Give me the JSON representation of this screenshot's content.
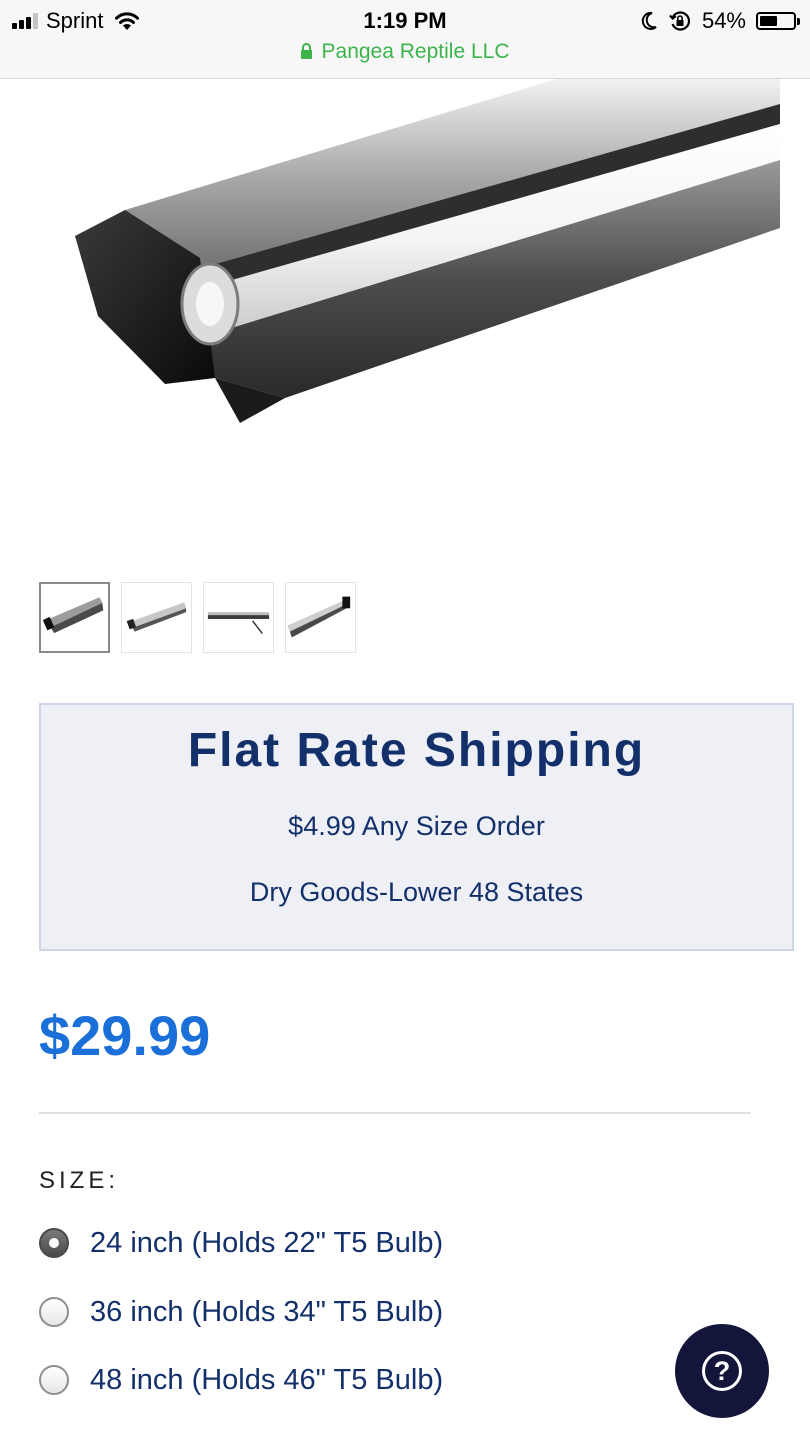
{
  "status_bar": {
    "carrier": "Sprint",
    "time": "1:19 PM",
    "battery_percent": "54%",
    "battery_level": 0.54,
    "site_name": "Pangea Reptile LLC",
    "icons": [
      "signal-icon",
      "wifi-icon",
      "moon-icon",
      "rotation-lock-icon",
      "battery-icon",
      "lock-icon"
    ]
  },
  "product": {
    "image_icon": "t5-light-fixture-image",
    "thumbnails": [
      {
        "name": "thumbnail-1",
        "selected": true
      },
      {
        "name": "thumbnail-2",
        "selected": false
      },
      {
        "name": "thumbnail-3",
        "selected": false
      },
      {
        "name": "thumbnail-4",
        "selected": false
      }
    ],
    "price": "$29.99"
  },
  "shipping": {
    "title": "Flat Rate Shipping",
    "line1": "$4.99 Any Size Order",
    "line2": "Dry Goods-Lower 48 States"
  },
  "size": {
    "label": "SIZE:",
    "options": [
      {
        "label": "24 inch (Holds 22\" T5 Bulb)",
        "checked": true
      },
      {
        "label": "36 inch (Holds 34\" T5 Bulb)",
        "checked": false
      },
      {
        "label": "48 inch (Holds 46\" T5 Bulb)",
        "checked": false
      }
    ]
  },
  "help": {
    "icon": "question-mark-icon",
    "glyph": "?"
  },
  "colors": {
    "navy": "#13306b",
    "price_blue": "#1a6fd8",
    "secure_green": "#3cb44b",
    "help_bg": "#13153a",
    "shipping_bg": "#eef0f6"
  }
}
